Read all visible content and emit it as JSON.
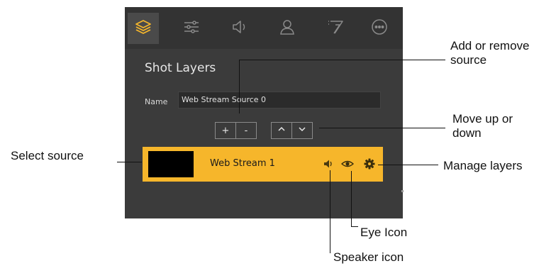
{
  "panel": {
    "title": "Shot Layers",
    "toolbar": {
      "icons": [
        "layers-icon",
        "sliders-icon",
        "speaker-icon",
        "person-icon",
        "transition-icon",
        "more-icon"
      ],
      "active_color": "#f6b62b",
      "inactive_color": "#8a8a8a"
    },
    "name_field": {
      "label": "Name",
      "value": "Web Stream Source 0"
    },
    "buttons": {
      "add": "+",
      "remove": "-"
    },
    "layer": {
      "name": "Web Stream 1",
      "row_color": "#f6b62b"
    }
  },
  "annotations": {
    "add_remove": "Add or remove\nsource",
    "move": "Move up or\ndown",
    "select": "Select source",
    "manage": "Manage layers",
    "eye": "Eye Icon",
    "speaker": "Speaker icon"
  }
}
